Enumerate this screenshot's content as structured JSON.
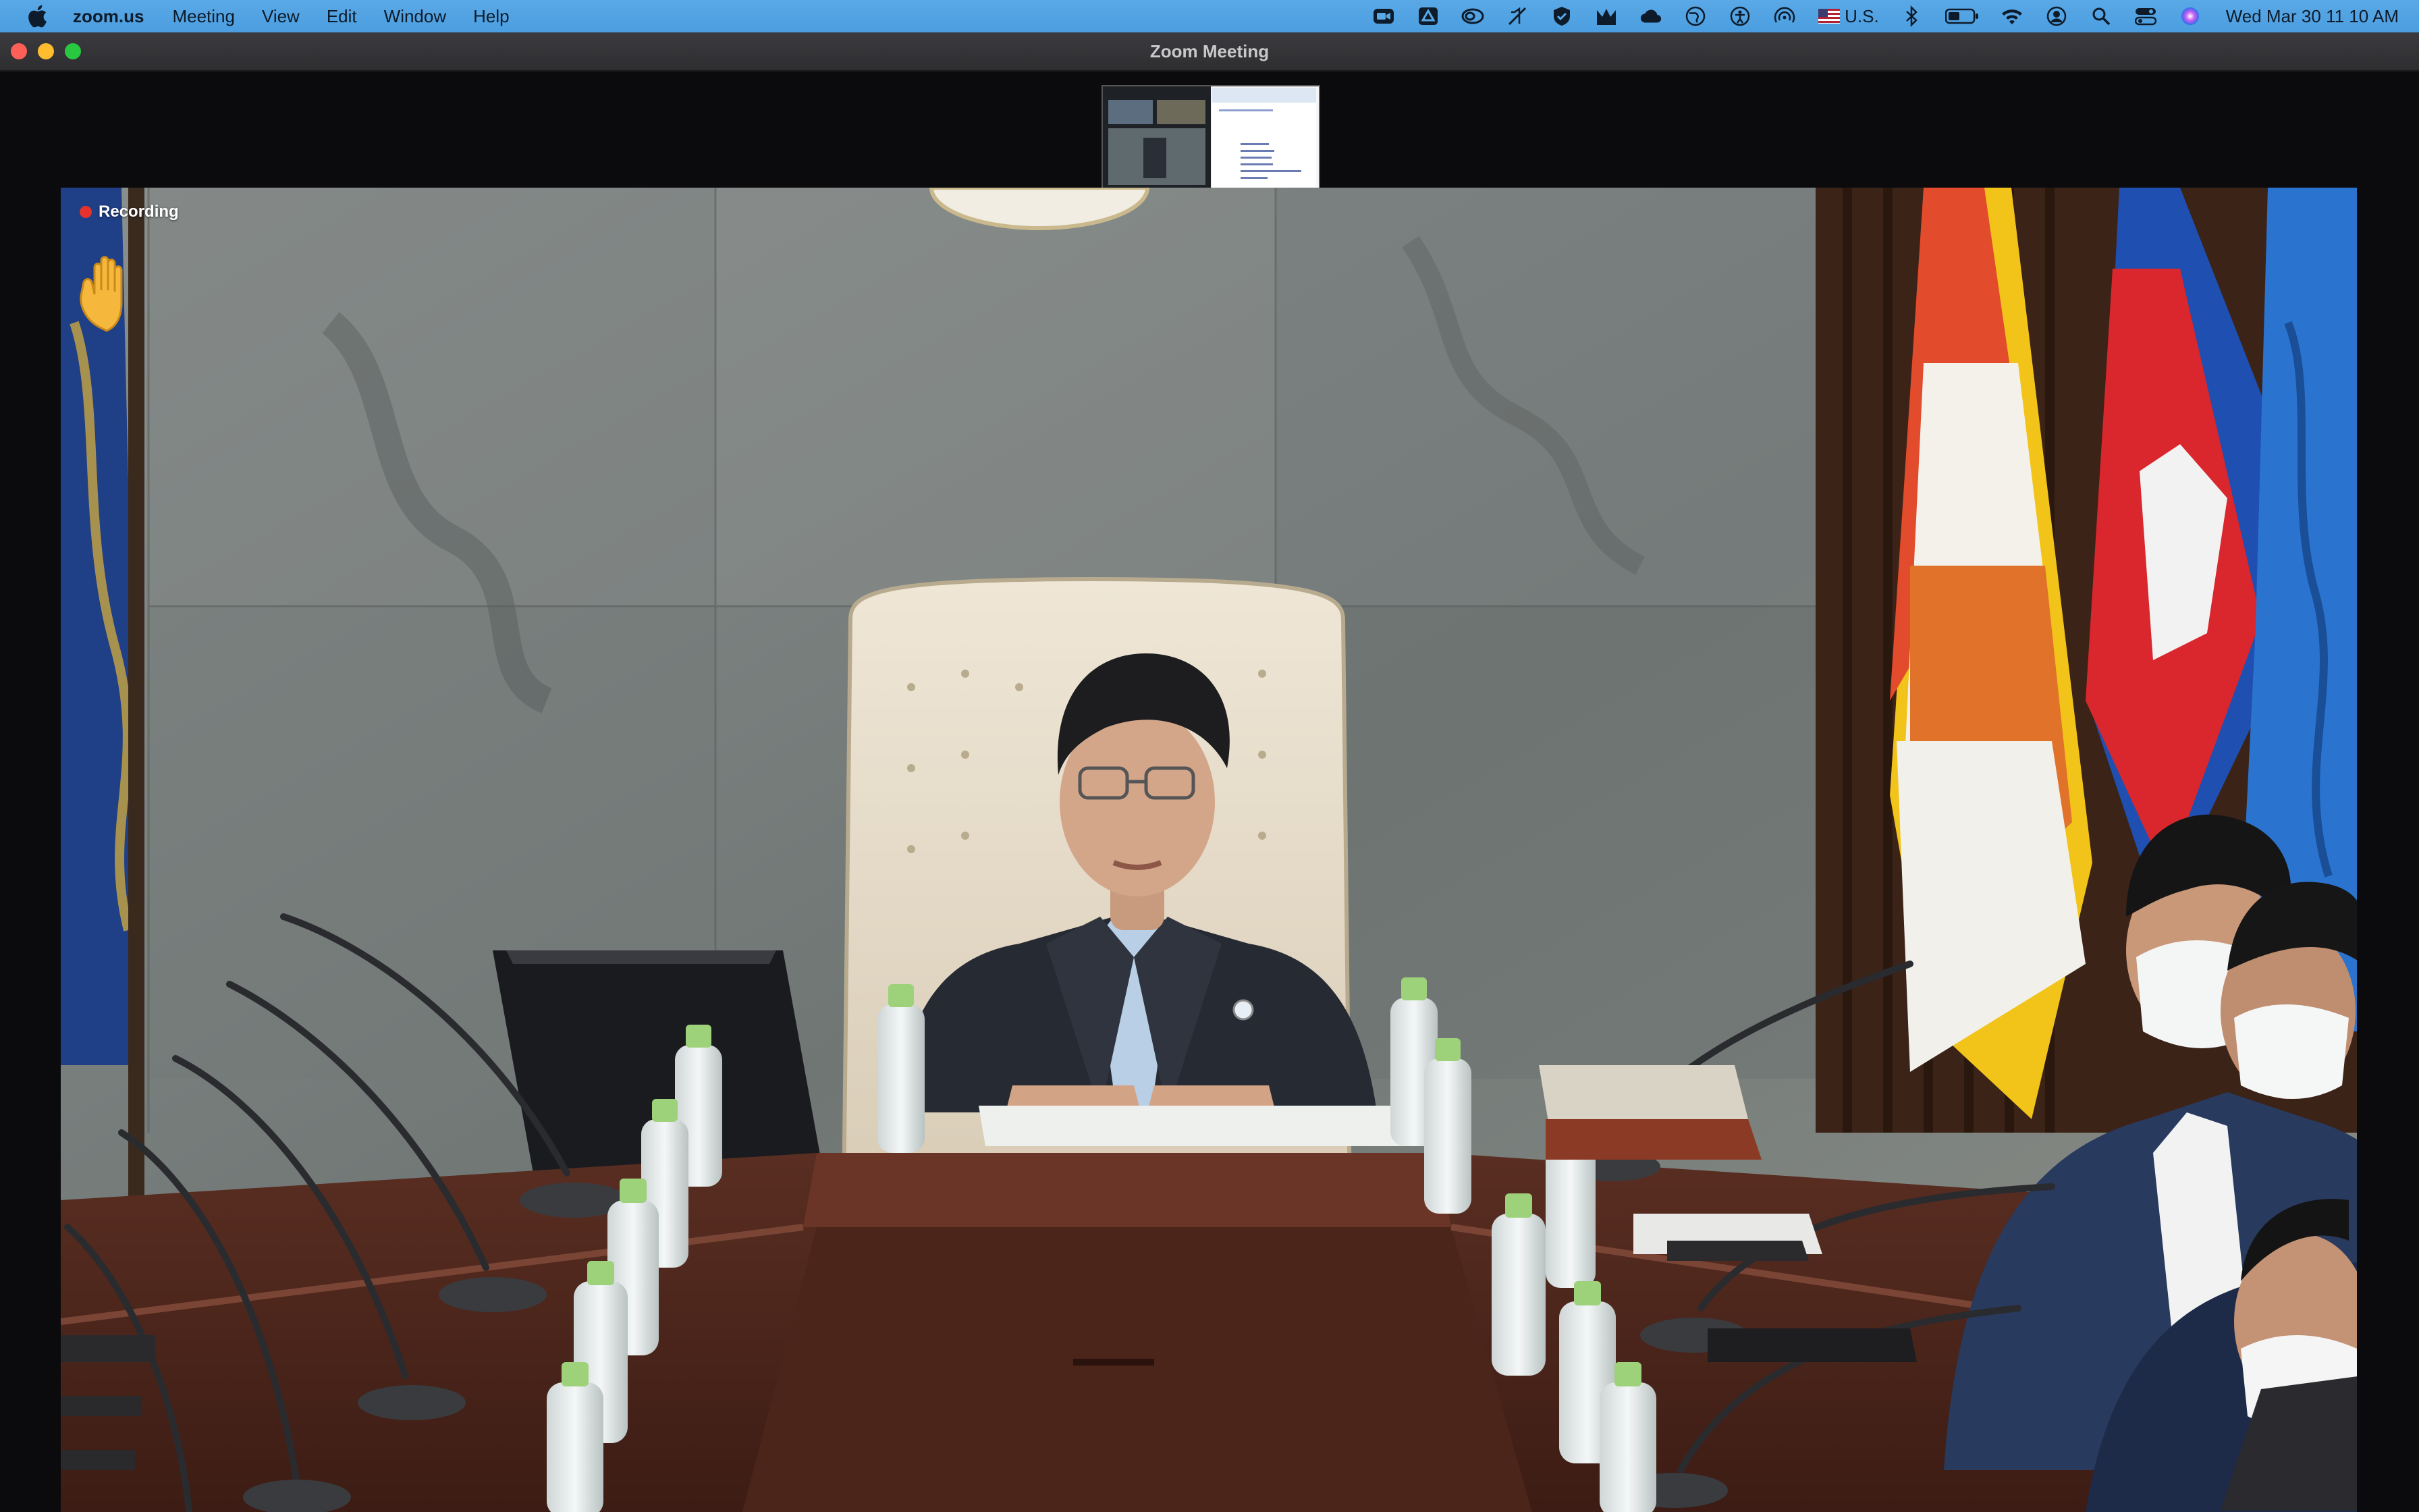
{
  "menubar": {
    "app_name": "zoom.us",
    "items": [
      "Meeting",
      "View",
      "Edit",
      "Window",
      "Help"
    ],
    "input_source": "U.S.",
    "clock": "Wed Mar 30  11 10 AM",
    "status_icons": [
      "zoom-video-icon",
      "drive-icon",
      "creative-cloud-icon",
      "mute-icon",
      "shield-icon",
      "malwarebytes-icon",
      "cloud-icon",
      "globe-icon",
      "accessibility-icon",
      "airdrop-icon",
      "flag-us-icon",
      "bluetooth-icon",
      "battery-icon",
      "wifi-icon",
      "user-icon",
      "search-icon",
      "control-center-icon",
      "siri-icon"
    ]
  },
  "window": {
    "title": "Zoom Meeting"
  },
  "video": {
    "recording_label": "Recording",
    "raised_hand": true
  },
  "colors": {
    "menubar_bg": "#4b9ee0",
    "recording_dot": "#e5322d",
    "window_bg": "#0b0b0d"
  }
}
